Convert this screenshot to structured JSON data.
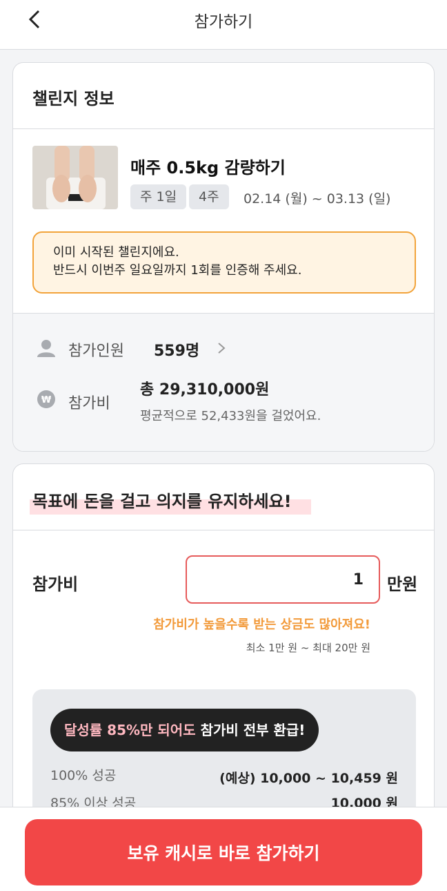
{
  "header": {
    "title": "참가하기"
  },
  "challenge_info": {
    "section_title": "챌린지 정보",
    "name": "매주 0.5kg 감량하기",
    "chips": [
      "주 1일",
      "4주"
    ],
    "period": "02.14 (월) ~ 03.13 (일)",
    "notice_line1": "이미 시작된 챌린지에요.",
    "notice_line2": "반드시 이번주 일요일까지 1회를 인증해 주세요."
  },
  "stats": {
    "participants_label": "참가인원",
    "participants_value": "559명",
    "fee_label": "참가비",
    "fee_total": "총 29,310,000원",
    "fee_avg": "평균적으로 52,433원을 걸었어요."
  },
  "goal": {
    "title": "목표에 돈을 걸고 의지를 유지하세요!",
    "fee_label": "참가비",
    "fee_value": "1",
    "fee_unit": "만원",
    "hint": "참가비가 높을수록 받는 상금도 많아져요!",
    "range": "최소 1만 원 ~ 최대 20만 원"
  },
  "refund": {
    "pill_highlight": "달성률 85%만 되어도",
    "pill_rest": " 참가비 전부 환급!",
    "rows": [
      {
        "label": "100% 성공",
        "value": "(예상) 10,000 ~ 10,459 원"
      },
      {
        "label": "85% 이상 성공",
        "value": "10,000 원"
      }
    ]
  },
  "cta": {
    "label": "보유 캐시로 바로 참가하기"
  },
  "colors": {
    "accent": "#f24747",
    "warning": "#f29a3a",
    "notice_bg": "#fff4e3"
  }
}
